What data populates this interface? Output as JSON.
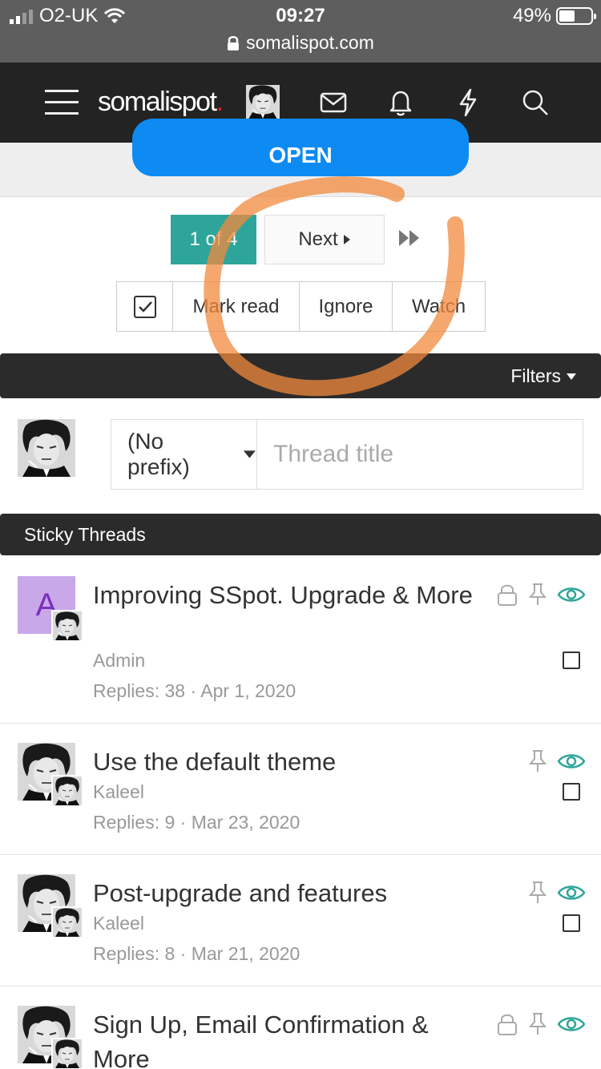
{
  "status_bar": {
    "carrier": "O2-UK",
    "time": "09:27",
    "battery": "49%",
    "battery_level": 0.49,
    "url": "somalispot.com"
  },
  "nav": {
    "logo": "somalispot",
    "logo_dot": ".",
    "icons": [
      "menu-icon",
      "avatar",
      "mail-icon",
      "bell-icon",
      "lightning-icon",
      "search-icon"
    ]
  },
  "open_button": "OPEN",
  "pagination": {
    "current": "1 of 4",
    "next": "Next"
  },
  "actions": {
    "mark_read": "Mark read",
    "ignore": "Ignore",
    "watch": "Watch"
  },
  "filters": {
    "label": "Filters"
  },
  "new_thread": {
    "prefix": "(No prefix)",
    "title_placeholder": "Thread title"
  },
  "sticky_header": "Sticky Threads",
  "threads": [
    {
      "avatar_letter": "A",
      "title": "Improving SSpot. Upgrade & More",
      "author": "Admin",
      "meta": "Replies: 38 · Apr 1, 2020",
      "icons": [
        "lock-icon",
        "pin-icon",
        "eye-icon"
      ]
    },
    {
      "title": "Use the default theme",
      "author": "Kaleel",
      "meta": "Replies: 9 · Mar 23, 2020",
      "icons": [
        "pin-icon",
        "eye-icon"
      ]
    },
    {
      "title": "Post-upgrade and features",
      "author": "Kaleel",
      "meta": "Replies: 8 · Mar 21, 2020",
      "icons": [
        "pin-icon",
        "eye-icon"
      ]
    },
    {
      "title": "Sign Up, Email Confirmation & More",
      "icons": [
        "lock-icon",
        "pin-icon",
        "eye-icon"
      ]
    }
  ],
  "colors": {
    "accent_teal": "#2ea59a",
    "open_blue": "#0d8bf2",
    "nav_dark": "#232323",
    "logo_dot_red": "#e0201b",
    "scribble_orange": "#f28a3c",
    "avatar_purple": "#c9a8ea"
  }
}
